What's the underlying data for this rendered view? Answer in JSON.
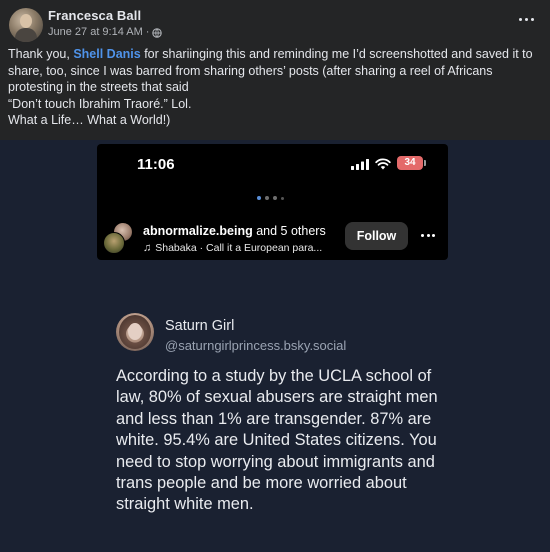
{
  "post": {
    "author": "Francesca Ball",
    "date": "June 27 at 9:14 AM",
    "dot": "·",
    "text": {
      "before_mention": "Thank you,  ",
      "mention": "Shell Danis",
      "after_mention": " for shariinging this and reminding me I’d screenshotted and saved it to share, too, since I was barred from sharing others’ posts (after sharing a reel of Africans protesting in the streets that said",
      "line2": "“Don’t touch Ibrahim Traoré.” Lol.",
      "line3": "What a Life… What a World!)"
    }
  },
  "screenshot": {
    "status_time": "11:06",
    "battery": "34",
    "reel": {
      "account": "abnormalize.being",
      "others": " and 5 others",
      "audio": "Shabaka · Call it a European para...",
      "follow_label": "Follow"
    }
  },
  "quote": {
    "name": "Saturn Girl",
    "handle": "@saturngirlprincess.bsky.social",
    "body": "According to a study by the UCLA school of law, 80% of sexual abusers are straight men and less than 1% are transgender. 87% are white. 95.4% are United States citizens. You need to stop worrying about immigrants and trans people and be more worried about straight white men."
  },
  "colors": {
    "post_bg": "#242526",
    "mention": "#4f93ea",
    "page_bg": "#1a2131",
    "battery": "#e46a6a"
  },
  "icons": [
    "globe-icon",
    "more-options-icon",
    "signal-icon",
    "wifi-icon",
    "battery-icon",
    "music-note-icon"
  ]
}
